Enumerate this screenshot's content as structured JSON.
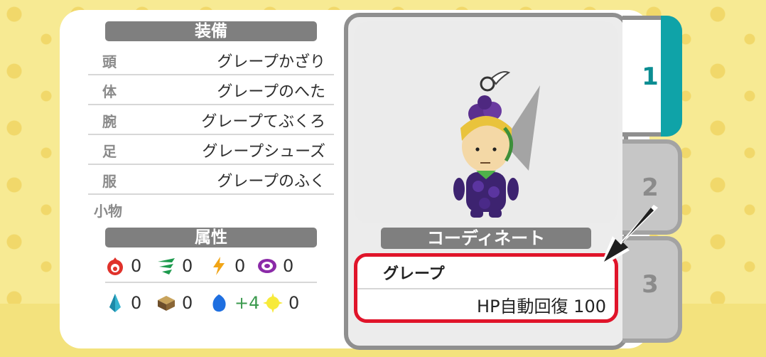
{
  "equipment": {
    "header": "装備",
    "rows": [
      {
        "slot": "頭",
        "item": "グレープかざり"
      },
      {
        "slot": "体",
        "item": "グレープのへた"
      },
      {
        "slot": "腕",
        "item": "グレープてぶくろ"
      },
      {
        "slot": "足",
        "item": "グレープシューズ"
      },
      {
        "slot": "服",
        "item": "グレープのふく"
      }
    ],
    "accessory_slot": "小物"
  },
  "attributes": {
    "header": "属性",
    "row1": [
      {
        "icon": "fire-icon",
        "value": "0"
      },
      {
        "icon": "wind-icon",
        "value": "0"
      },
      {
        "icon": "lightning-icon",
        "value": "0"
      },
      {
        "icon": "spiral-icon",
        "value": "0"
      }
    ],
    "row2": [
      {
        "icon": "crystal-icon",
        "value": "0"
      },
      {
        "icon": "earth-icon",
        "value": "0"
      },
      {
        "icon": "water-icon",
        "value": "+4"
      },
      {
        "icon": "light-icon",
        "value": "0"
      }
    ]
  },
  "coordinate": {
    "header": "コーディネート",
    "set_name": "グレープ",
    "bonus": "HP自動回復 100"
  },
  "tabs": [
    "1",
    "2",
    "3"
  ],
  "colors": {
    "active_tab": "#0fa3a8",
    "highlight_border": "#e0142a",
    "header_bg": "#7f7f7f",
    "positive_value": "#3b9a4e"
  }
}
